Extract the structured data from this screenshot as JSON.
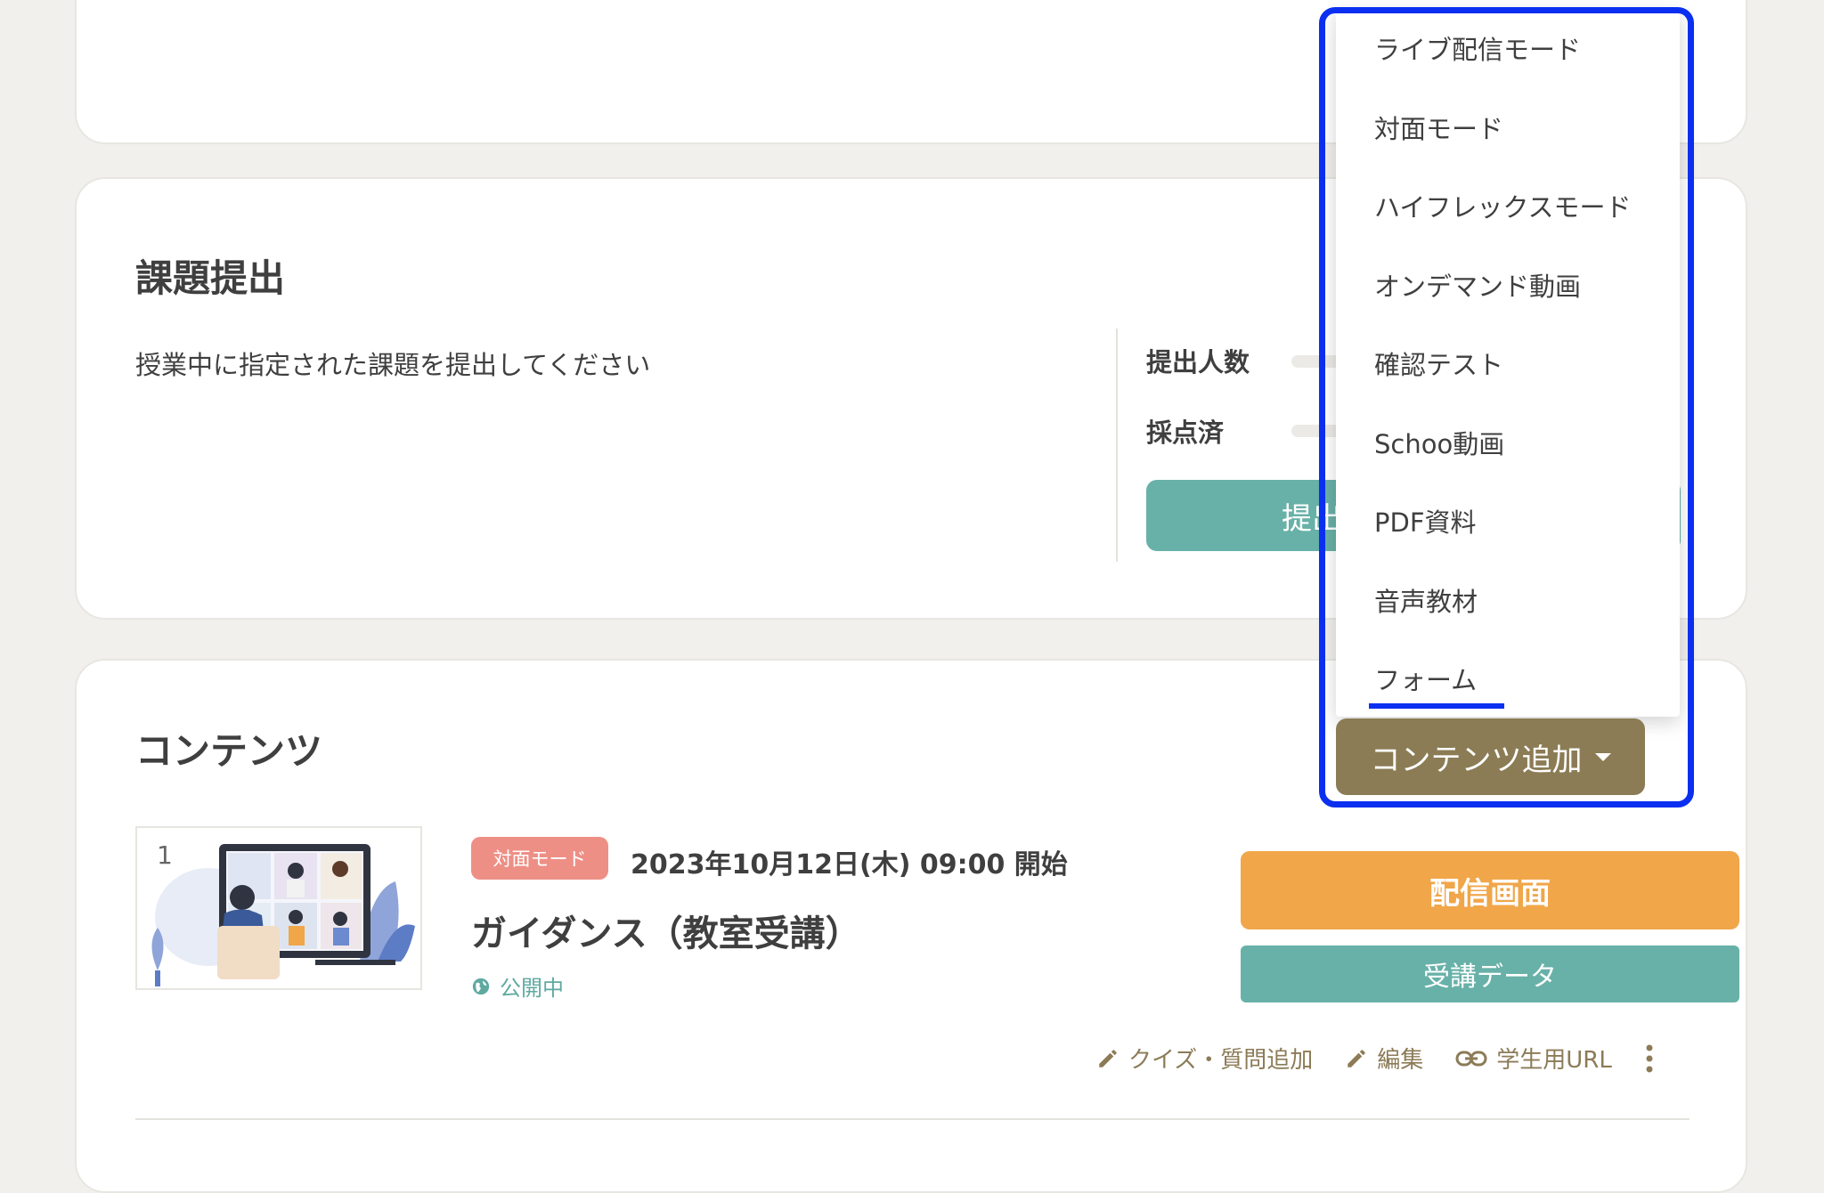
{
  "assignment": {
    "title": "課題提出",
    "description": "授業中に指定された課題を提出してください",
    "stats": {
      "submitted_label": "提出人数",
      "graded_label": "採点済"
    },
    "submit_button_label": "提出"
  },
  "contents": {
    "title": "コンテンツ",
    "add_button_label": "コンテンツ追加",
    "dropdown_items": [
      "ライブ配信モード",
      "対面モード",
      "ハイフレックスモード",
      "オンデマンド動画",
      "確認テスト",
      "Schoo動画",
      "PDF資料",
      "音声教材",
      "フォーム"
    ],
    "items": [
      {
        "number": "1",
        "mode_badge": "対面モード",
        "datetime": "2023年10月12日(木) 09:00 開始",
        "title": "ガイダンス（教室受講）",
        "status": "公開中",
        "stream_button": "配信画面",
        "data_button": "受講データ",
        "actions": {
          "quiz": "クイズ・質問追加",
          "edit": "編集",
          "student_url": "学生用URL"
        }
      }
    ]
  },
  "colors": {
    "accent_brown": "#8b7c55",
    "teal": "#68b1a8",
    "orange": "#f0a649",
    "badge_red": "#ee8f86",
    "highlight_blue": "#0b2ff0"
  },
  "icons": [
    "globe-icon",
    "pencil-icon",
    "link-icon",
    "kebab-icon",
    "caret-down-icon"
  ]
}
